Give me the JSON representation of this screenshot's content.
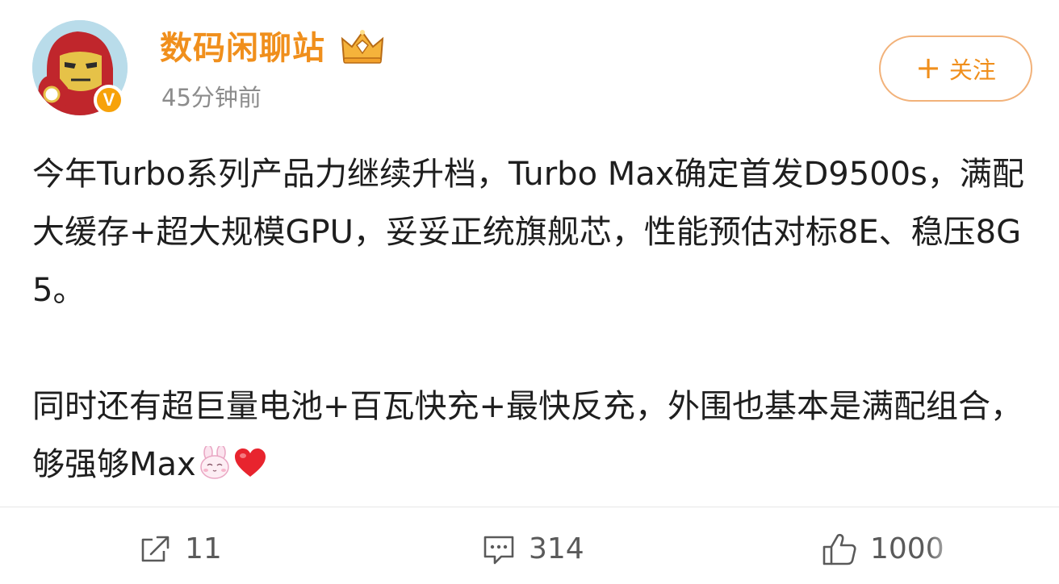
{
  "post": {
    "author": {
      "name": "数码闲聊站",
      "verified_badge": "V",
      "time": "45分钟前"
    },
    "follow_button": {
      "plus": "+",
      "label": "关注"
    },
    "paragraphs": [
      "今年Turbo系列产品力继续升档，Turbo Max确定首发D9500s，满配大缓存+超大规模GPU，妥妥正统旗舰芯，性能预估对标8E、稳压8G5。",
      "同时还有超巨量电池+百瓦快充+最快反充，外围也基本是满配组合，够强够Max"
    ],
    "trailing_emojis": [
      "bunny-face-emoji",
      "red-heart-emoji"
    ]
  },
  "actions": {
    "repost": {
      "icon": "repost-icon",
      "count": "11"
    },
    "comment": {
      "icon": "comment-icon",
      "count": "314"
    },
    "like": {
      "icon": "thumbs-up-icon",
      "count": "1000"
    }
  },
  "colors": {
    "brand_orange": "#f08f1c",
    "follow_border": "#f2b27a",
    "verify_badge": "#f7a20a",
    "timestamp_gray": "#8c8c8c",
    "text_dark": "#1e1e1e",
    "action_gray": "#5a5a5a"
  }
}
